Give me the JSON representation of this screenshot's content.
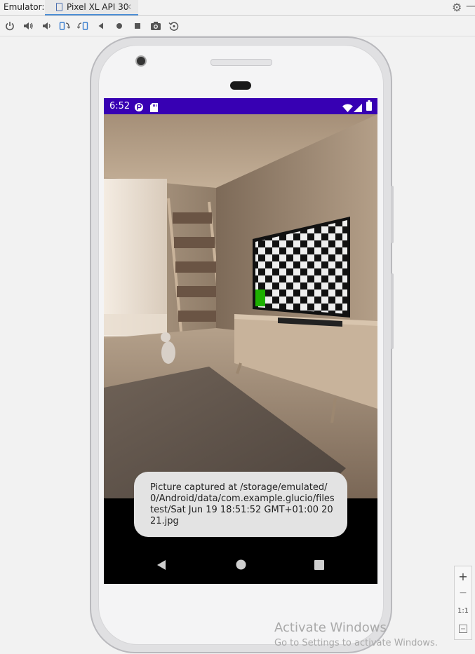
{
  "topbar": {
    "emulator_label": "Emulator:",
    "device_tab": "Pixel XL API 30",
    "close_glyph": "✕",
    "settings_icon": "gear-icon"
  },
  "toolbar": {
    "buttons": [
      "power",
      "volume-up",
      "volume-down",
      "rotate-left",
      "rotate-right",
      "back",
      "home",
      "overview",
      "screenshot",
      "snapshot"
    ]
  },
  "device": {
    "status_time": "6:52",
    "status_bar_color": "#3700b3",
    "toast": "Picture captured at /storage/emulated/0/Android/data/com.example.glucio/filestest/Sat Jun 19 18:51:52 GMT+01:00 2021.jpg"
  },
  "zoom": {
    "zoom_in": "+",
    "zoom_out": "−",
    "actual_size": "1:1"
  },
  "watermark": {
    "title": "Activate Windows",
    "subtitle": "Go to Settings to activate Windows."
  }
}
